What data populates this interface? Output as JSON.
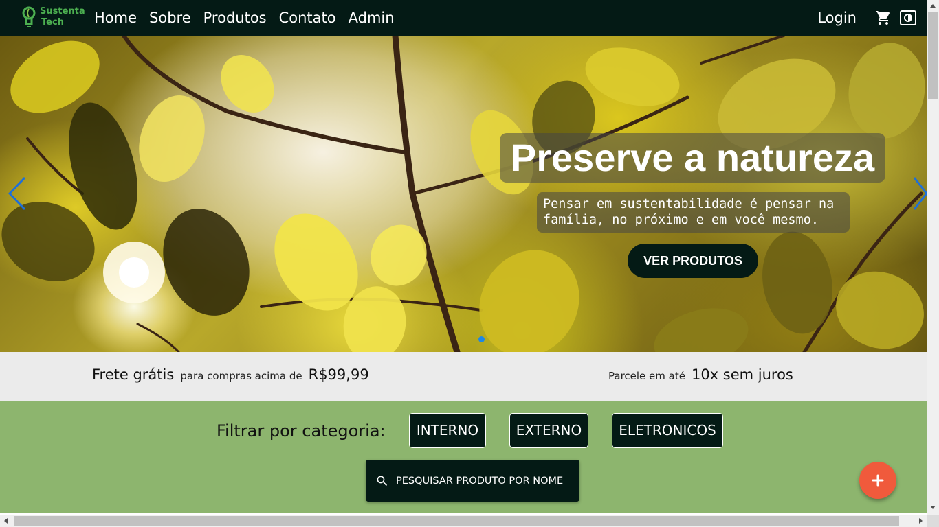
{
  "brand": {
    "line1": "Sustenta",
    "line2": "Tech"
  },
  "nav": {
    "links": [
      "Home",
      "Sobre",
      "Produtos",
      "Contato",
      "Admin"
    ],
    "login": "Login",
    "cart_icon": "shopping-cart-icon",
    "theme_icon": "theme-toggle-icon"
  },
  "hero": {
    "title": "Preserve a natureza",
    "subtitle": "Pensar em sustentabilidade é pensar na família, no próximo e em você mesmo.",
    "button": "VER PRODUTOS",
    "prev_icon": "chevron-left-icon",
    "next_icon": "chevron-right-icon",
    "indicator_color": "#1e88e5"
  },
  "info": {
    "shipping_strong": "Frete grátis",
    "shipping_text": "para compras acima de",
    "shipping_value": "R$99,99",
    "installments_text": "Parcele em até",
    "installments_strong": "10x sem juros"
  },
  "filter": {
    "label": "Filtrar por categoria:",
    "categories": [
      "INTERNO",
      "EXTERNO",
      "ELETRONICOS"
    ],
    "search_button": "PESQUISAR PRODUTO POR NOME",
    "search_icon": "search-icon",
    "fab_icon": "plus-icon"
  },
  "colors": {
    "navbar": "#041a15",
    "filter_bg": "#8db56e",
    "info_bg": "#ebebeb",
    "fab": "#f05a3c",
    "logo_green": "#4caf50"
  }
}
